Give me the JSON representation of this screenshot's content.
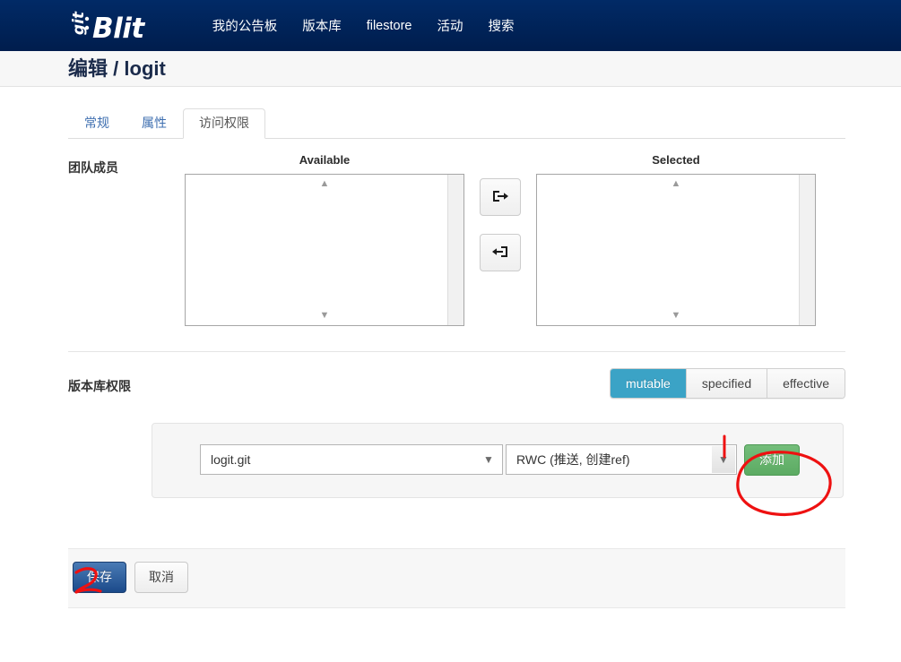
{
  "navbar": {
    "brand": "Blit",
    "brand_mark": "git",
    "links": [
      {
        "label": "我的公告板",
        "name": "nav-my-dashboard"
      },
      {
        "label": "版本库",
        "name": "nav-repositories"
      },
      {
        "label": "filestore",
        "name": "nav-filestore"
      },
      {
        "label": "活动",
        "name": "nav-activity"
      },
      {
        "label": "搜索",
        "name": "nav-search"
      }
    ]
  },
  "page": {
    "title_prefix": "编辑",
    "separator": "/",
    "title_name": "logit"
  },
  "tabs": [
    {
      "label": "常规",
      "active": false
    },
    {
      "label": "属性",
      "active": false
    },
    {
      "label": "访问权限",
      "active": true
    }
  ],
  "team_members": {
    "label": "团队成员",
    "available_header": "Available",
    "selected_header": "Selected",
    "available_items": [],
    "selected_items": [],
    "move_right_icon": "arrow-into-box-right-icon",
    "move_left_icon": "arrow-into-box-left-icon"
  },
  "repo_permissions": {
    "label": "版本库权限",
    "view_modes": [
      {
        "label": "mutable",
        "active": true
      },
      {
        "label": "specified",
        "active": false
      },
      {
        "label": "effective",
        "active": false
      }
    ],
    "repo_select": {
      "value": "logit.git",
      "options": [
        "logit.git"
      ]
    },
    "permission_select": {
      "value": "RWC (推送, 创建ref)",
      "options": [
        "RWC (推送, 创建ref)"
      ]
    },
    "add_label": "添加"
  },
  "footer": {
    "save_label": "保存",
    "cancel_label": "取消"
  },
  "annotations": {
    "marker_one": "1",
    "marker_two": "2",
    "circle_target": "添加",
    "colors": {
      "ink": "#ee1111"
    }
  },
  "colors": {
    "navbar_bg": "#00235b",
    "accent_active": "#3ba3c6",
    "add_button": "#5cab63",
    "save_button": "#1b4a8a",
    "tab_link": "#3f6fb0"
  }
}
